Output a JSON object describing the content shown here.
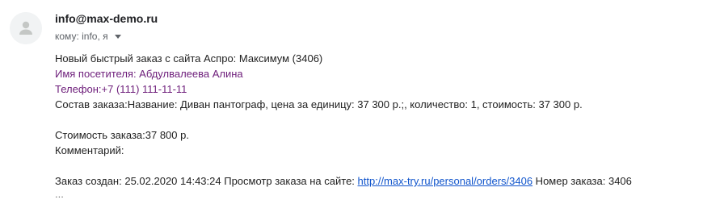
{
  "header": {
    "sender": "info@max-demo.ru",
    "recipients_label": "кому: info, я"
  },
  "icons": {
    "avatar": "person-avatar-icon",
    "recipients_caret": "caret-down-icon"
  },
  "colors": {
    "purple_text": "#6d1d7a",
    "link": "#1155cc"
  },
  "message": {
    "line1": "Новый быстрый заказ с сайта Аспро: Максимум (3406)",
    "visitor_name": "Имя посетителя: Абдулвалеева Алина",
    "phone": "Телефон:+7 (111) 111-11-11",
    "order_content": "Состав заказа:Название: Диван пантограф, цена за единицу: 37 300 р.;, количество: 1, стоимость: 37 300 р.",
    "order_cost": "Стоимость заказа:37 800 р.",
    "comment": "Комментарий:",
    "created_prefix": "Заказ создан: 25.02.2020 14:43:24 Просмотр заказа на сайте: ",
    "order_link": "http://max-try.ru/personal/orders/3406",
    "order_number": " Номер заказа: 3406",
    "trimmed": "..."
  }
}
